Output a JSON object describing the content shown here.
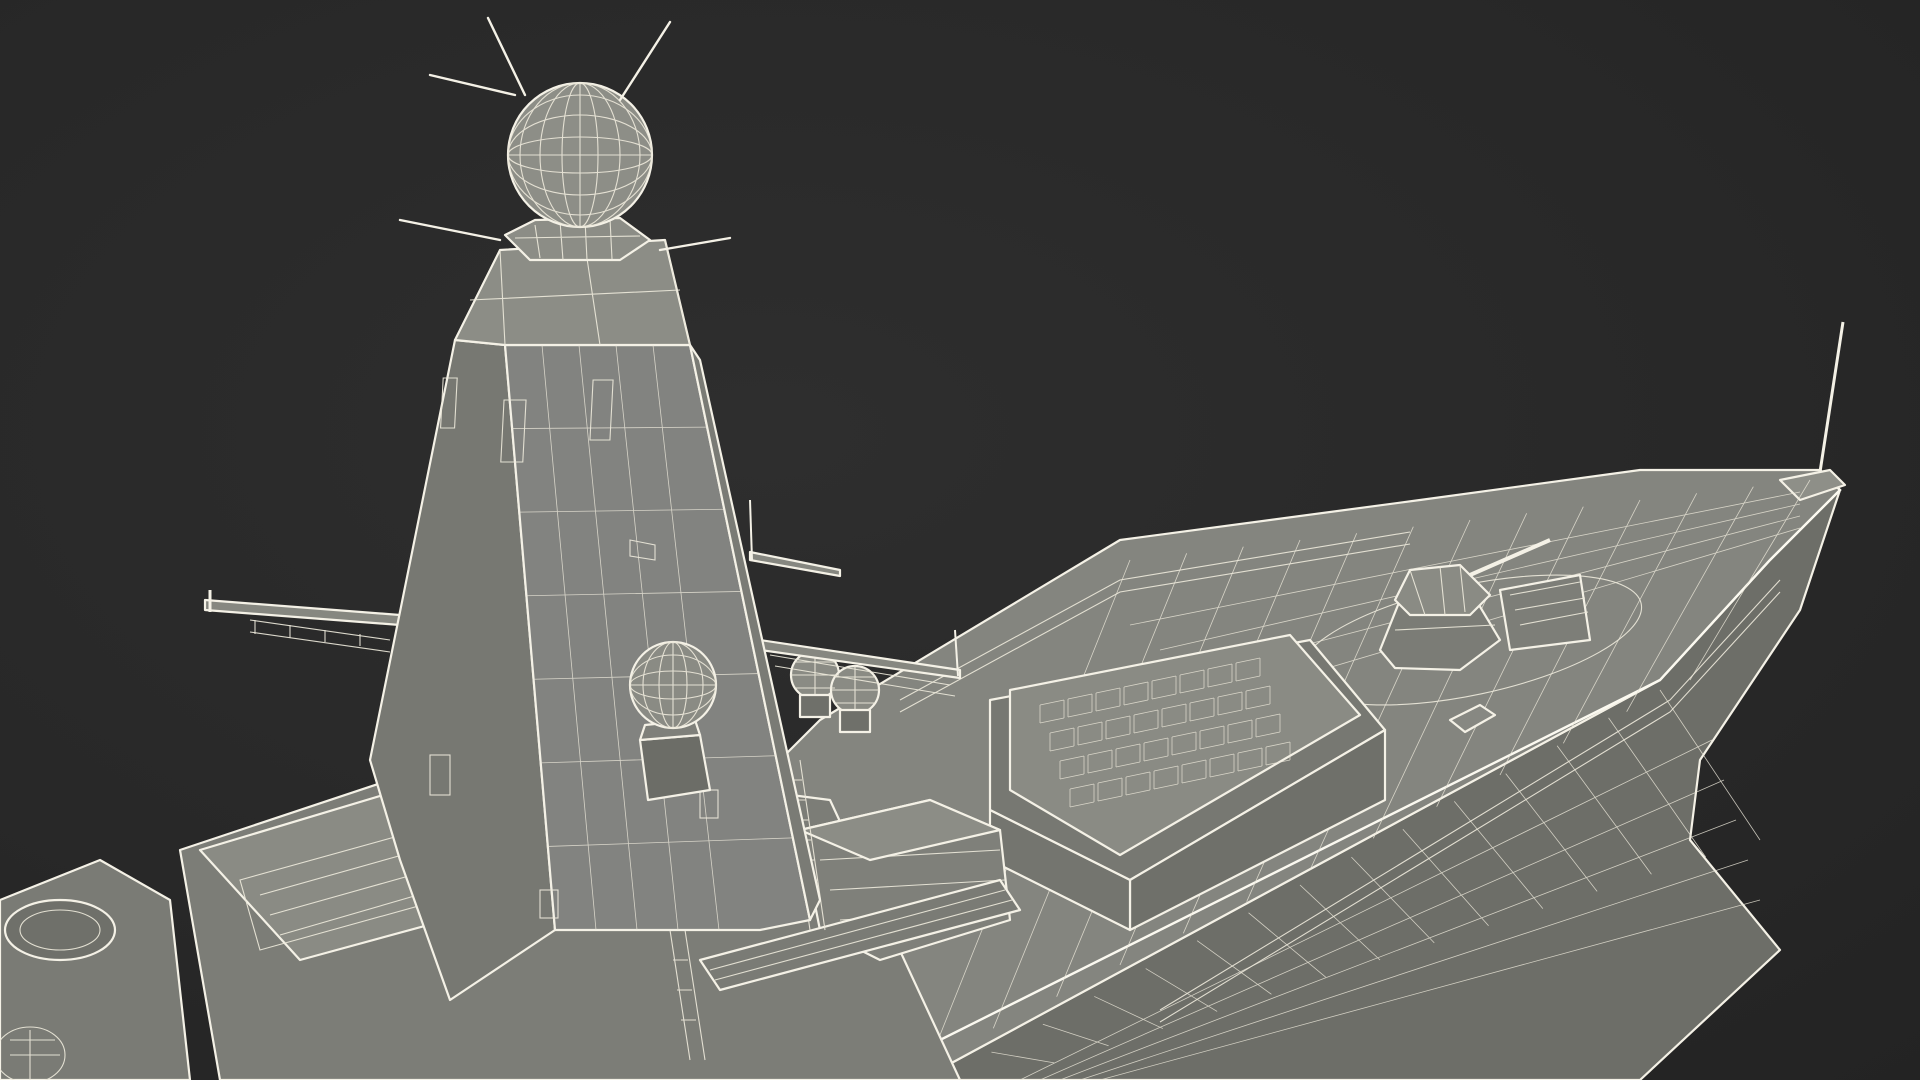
{
  "scene": {
    "subject": "",
    "colors": {
      "background": "#2a2a2a",
      "surface": "#7f807a",
      "surface_light": "#8c8d86",
      "surface_dark": "#6c6d67",
      "wireframe": "#ece8da"
    }
  }
}
